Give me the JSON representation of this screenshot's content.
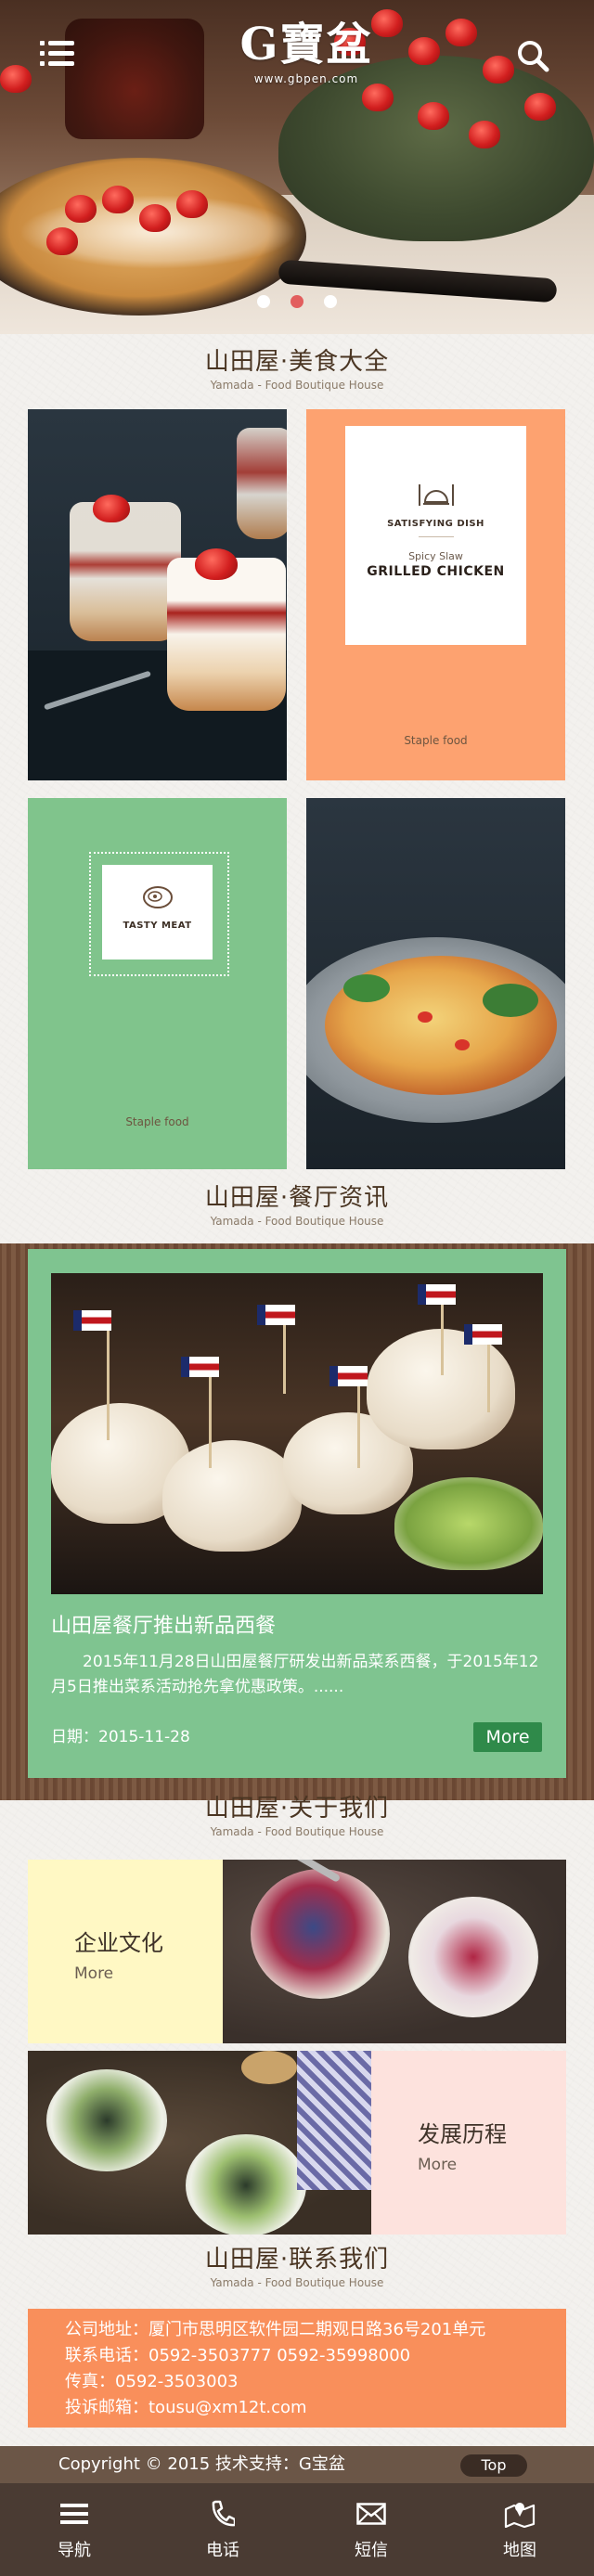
{
  "header": {
    "logo_text": "G寶盆",
    "logo_url": "www.gbpen.com",
    "menu_icon": "menu-icon",
    "search_icon": "search-icon"
  },
  "carousel": {
    "count": 3,
    "active": 2
  },
  "food_section": {
    "title": "山田屋·美食大全",
    "subtitle": "Yamada - Food Boutique House",
    "tiles": [
      {
        "kind": "image",
        "icon": "dessert-jars"
      },
      {
        "kind": "card",
        "label": "SATISFYING DISH",
        "sub": "Spicy Slaw",
        "name": "GRILLED CHICKEN",
        "footer": "Staple food",
        "icon": "cloche-icon"
      },
      {
        "kind": "card",
        "label": "TASTY MEAT",
        "footer": "Staple food",
        "icon": "steak-icon"
      },
      {
        "kind": "image",
        "icon": "fried-rice"
      }
    ]
  },
  "news_section": {
    "title": "山田屋·餐厅资讯",
    "subtitle": "Yamada - Food Boutique House",
    "article": {
      "title": "山田屋餐厅推出新品西餐",
      "summary": "2015年11月28日山田屋餐厅研发出新品菜系西餐，于2015年12月5日推出菜系活动抢先拿优惠政策。......",
      "date": "日期：2015-11-28",
      "more_label": "More"
    }
  },
  "about_section": {
    "title": "山田屋·关于我们",
    "subtitle": "Yamada - Food Boutique House",
    "items": [
      {
        "title": "企业文化",
        "more": "More"
      },
      {
        "title": "发展历程",
        "more": "More"
      }
    ]
  },
  "contact_section": {
    "title": "山田屋·联系我们",
    "subtitle": "Yamada - Food Boutique House",
    "address": "公司地址：厦门市思明区软件园二期观日路36号201单元",
    "phone": "联系电话：0592-3503777    0592-35998000",
    "fax": "传真：0592-3503003",
    "email": "投诉邮箱：tousu@xm12t.com"
  },
  "footer": {
    "copyright": "Copyright  © 2015 技术支持：G宝盆",
    "top_label": "Top",
    "nav": [
      {
        "label": "导航",
        "icon": "menu-icon"
      },
      {
        "label": "电话",
        "icon": "phone-icon"
      },
      {
        "label": "短信",
        "icon": "envelope-icon"
      },
      {
        "label": "地图",
        "icon": "map-icon"
      }
    ]
  },
  "colors": {
    "orange_tile": "#fda270",
    "green_tile": "#80c48c",
    "news_green": "#7fc490",
    "more_button": "#2f8a4a",
    "contact_orange": "#f98f5b",
    "culture_bg": "#fff8c4",
    "history_bg": "#fde2dd",
    "footer_bar": "#6b5647",
    "bottom_nav": "#4a3b33",
    "carousel_active": "#e25e5e"
  }
}
